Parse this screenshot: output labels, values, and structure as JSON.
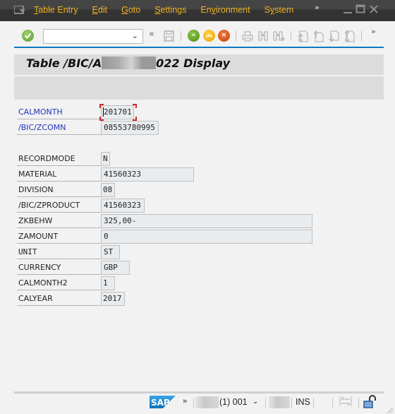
{
  "menubar": {
    "items": [
      {
        "label": "Table Entry",
        "mnemonic": "T",
        "rest": "able Entry"
      },
      {
        "label": "Edit",
        "mnemonic": "E",
        "rest": "dit"
      },
      {
        "label": "Goto",
        "mnemonic": "G",
        "rest": "oto"
      },
      {
        "label": "Settings",
        "mnemonic": "S",
        "rest": "ettings"
      },
      {
        "label": "Environment",
        "mnemonic": "v",
        "pre": "En",
        "rest": "ironment"
      },
      {
        "label": "System",
        "mnemonic": "y",
        "pre": "S",
        "rest": "stem"
      }
    ],
    "more_label": "»",
    "accent_color": "#f0b323"
  },
  "toolbar": {
    "command_field_value": "",
    "collapse_label": "«",
    "more_label": "»",
    "icons": [
      "enter-icon",
      "save-icon",
      "back-icon",
      "exit-icon",
      "cancel-icon",
      "print-icon",
      "find-icon",
      "find-next-icon",
      "first-page-icon",
      "previous-page-icon",
      "next-page-icon",
      "last-page-icon"
    ]
  },
  "screen": {
    "title_prefix": "Table /BIC/A",
    "title_suffix": "022 Display"
  },
  "key_fields": [
    {
      "label": "CALMONTH",
      "value": "201701",
      "focused": true
    },
    {
      "label": "/BIC/ZCOMN",
      "value": "08553780995"
    }
  ],
  "fields": [
    {
      "label": "RECORDMODE",
      "value": "N"
    },
    {
      "label": "MATERIAL",
      "value": "41560323"
    },
    {
      "label": "DIVISION",
      "value": "08"
    },
    {
      "label": "/BIC/ZPRODUCT",
      "value": "41560323"
    },
    {
      "label": "ZKBEHW",
      "value": "325,00-"
    },
    {
      "label": "ZAMOUNT",
      "value": "0"
    },
    {
      "label": "UNIT",
      "value": "ST"
    },
    {
      "label": "CURRENCY",
      "value": "GBP"
    },
    {
      "label": "CALMONTH2",
      "value": "1"
    },
    {
      "label": "CALYEAR",
      "value": "2017"
    }
  ],
  "statusbar": {
    "logo": "SAP",
    "more_label": "»",
    "session": "(1) 001",
    "mode": "INS"
  }
}
